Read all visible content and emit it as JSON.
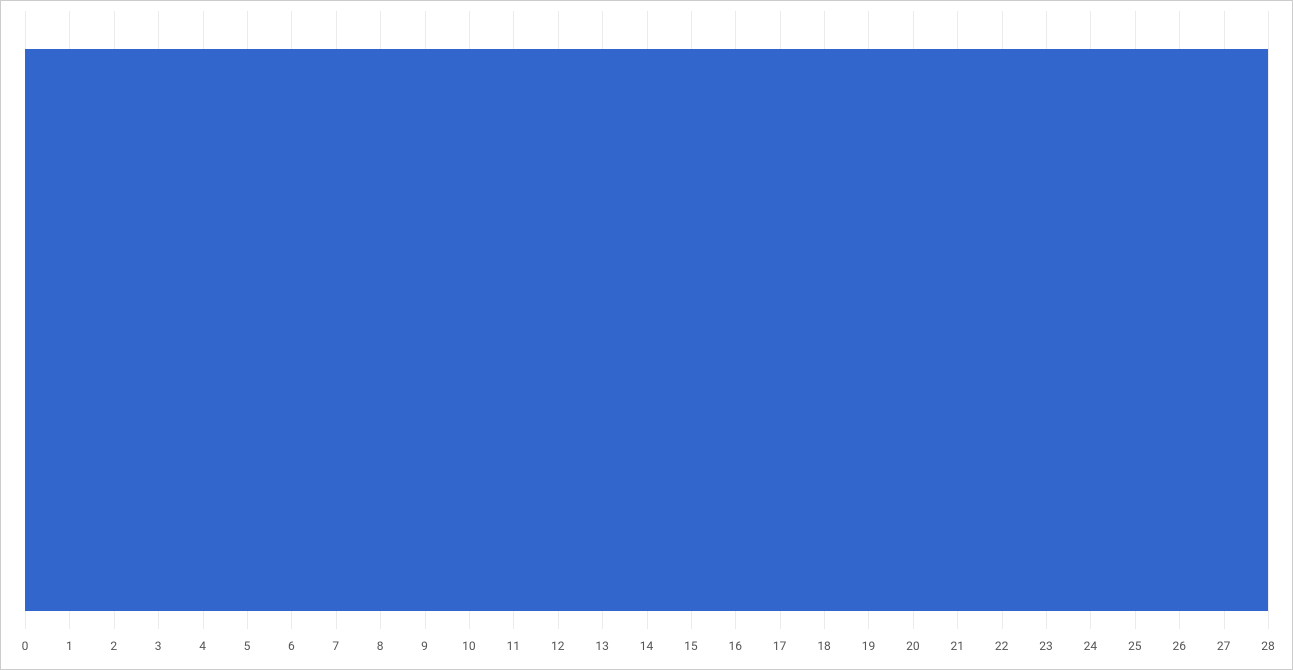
{
  "chart_data": {
    "type": "bar",
    "orientation": "horizontal",
    "categories": [
      ""
    ],
    "values": [
      28
    ],
    "title": "",
    "xlabel": "",
    "ylabel": "",
    "xlim": [
      0,
      28
    ],
    "x_ticks": [
      0,
      1,
      2,
      3,
      4,
      5,
      6,
      7,
      8,
      9,
      10,
      11,
      12,
      13,
      14,
      15,
      16,
      17,
      18,
      19,
      20,
      21,
      22,
      23,
      24,
      25,
      26,
      27,
      28
    ],
    "bar_color": "#3366cc"
  }
}
